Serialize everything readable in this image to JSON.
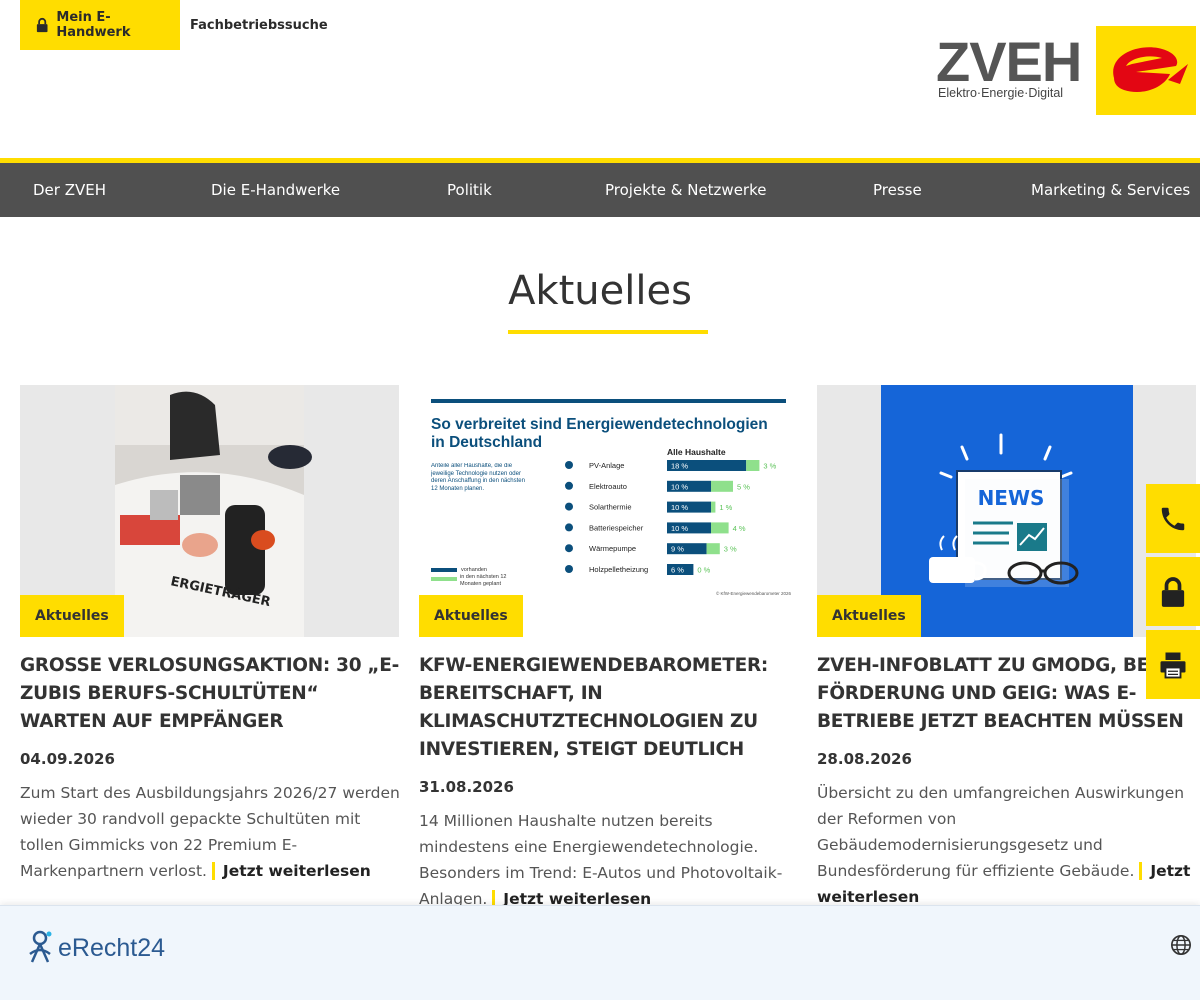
{
  "topbar": {
    "login_label": "Mein E-Handwerk",
    "finder_label": "Fachbetriebssuche"
  },
  "logo": {
    "name": "ZVEH",
    "tagline": "Elektro·Energie·Digital"
  },
  "nav": {
    "items": [
      "Der ZVEH",
      "Die E-Handwerke",
      "Politik",
      "Projekte & Netzwerke",
      "Presse",
      "Marketing & Services"
    ]
  },
  "section": {
    "title": "Aktuelles"
  },
  "cards": [
    {
      "category": "Aktuelles",
      "title": "GROSSE VERLOSUNGSAKTION: 30 „E-ZUBIS BERUFS-SCHULTÜTEN“ WARTEN AUF EMPFÄNGER",
      "date": "04.09.2026",
      "text": "Zum Start des Ausbildungsjahrs 2026/27 werden wieder 30 randvoll gepackte Schultüten mit tollen Gimmicks von 22 Premium E-Markenpartnern verlost.",
      "more": "Jetzt weiterlesen",
      "image_text": "ERGIETRÄGER"
    },
    {
      "category": "Aktuelles",
      "title": "KFW-ENERGIEWENDEBAROMETER: BEREITSCHAFT, IN KLIMASCHUTZTECHNOLOGIEN ZU INVESTIEREN, STEIGT DEUTLICH",
      "date": "31.08.2026",
      "text": "14 Millionen Haushalte nutzen bereits mindestens eine Energiewendetechnologie. Besonders im Trend: E-Autos und Photovoltaik-Anlagen.",
      "more": "Jetzt weiterlesen",
      "infographic": {
        "title": "So verbreitet sind Energiewendetechnologien in Deutschland",
        "note": "Anteile aller Haushalte, die die jeweilige Technologie nutzen oder deren Anschaffung in den nächsten 12 Monaten planen.",
        "column_header": "Alle Haushalte",
        "rows": [
          {
            "label": "PV-Anlage",
            "present": "18 %",
            "planned": "3 %",
            "present_pct": 18,
            "planned_pct": 3
          },
          {
            "label": "Elektroauto",
            "present": "10 %",
            "planned": "5 %",
            "present_pct": 10,
            "planned_pct": 5
          },
          {
            "label": "Solarthermie",
            "present": "10 %",
            "planned": "1 %",
            "present_pct": 10,
            "planned_pct": 1
          },
          {
            "label": "Batteriespeicher",
            "present": "10 %",
            "planned": "4 %",
            "present_pct": 10,
            "planned_pct": 4
          },
          {
            "label": "Wärmepumpe",
            "present": "9 %",
            "planned": "3 %",
            "present_pct": 9,
            "planned_pct": 3
          },
          {
            "label": "Holzpelletheizung",
            "present": "6 %",
            "planned": "0 %",
            "present_pct": 6,
            "planned_pct": 0
          }
        ],
        "legend_present": "vorhanden",
        "legend_planned": "in den nächsten 12 Monaten geplant",
        "source": "© KfW-Energiewendebarometer 2026",
        "colors": {
          "present": "#0b4f7c",
          "planned": "#8fe08c"
        }
      }
    },
    {
      "category": "Aktuelles",
      "title": "ZVEH-INFOBLATT ZU GMODG, BEG-FÖRDERUNG UND GEIG: WAS E-BETRIEBE JETZT BEACHTEN MÜSSEN",
      "date": "28.08.2026",
      "text": "Übersicht zu den umfangreichen Auswirkungen der Reformen von Gebäudemodernisierungsgesetz und Bundesförderung für effiziente Gebäude.",
      "more": "Jetzt weiterlesen",
      "image_text": "NEWS"
    }
  ],
  "side_buttons": [
    "phone-icon",
    "lock-icon",
    "printer-icon"
  ],
  "banner": {
    "brand": "eRecht24"
  },
  "colors": {
    "accent": "#ffdd00",
    "nav_bg": "#505050",
    "text": "#333333",
    "banner_bg": "#f0f6fc",
    "news_blue": "#1565d8"
  }
}
